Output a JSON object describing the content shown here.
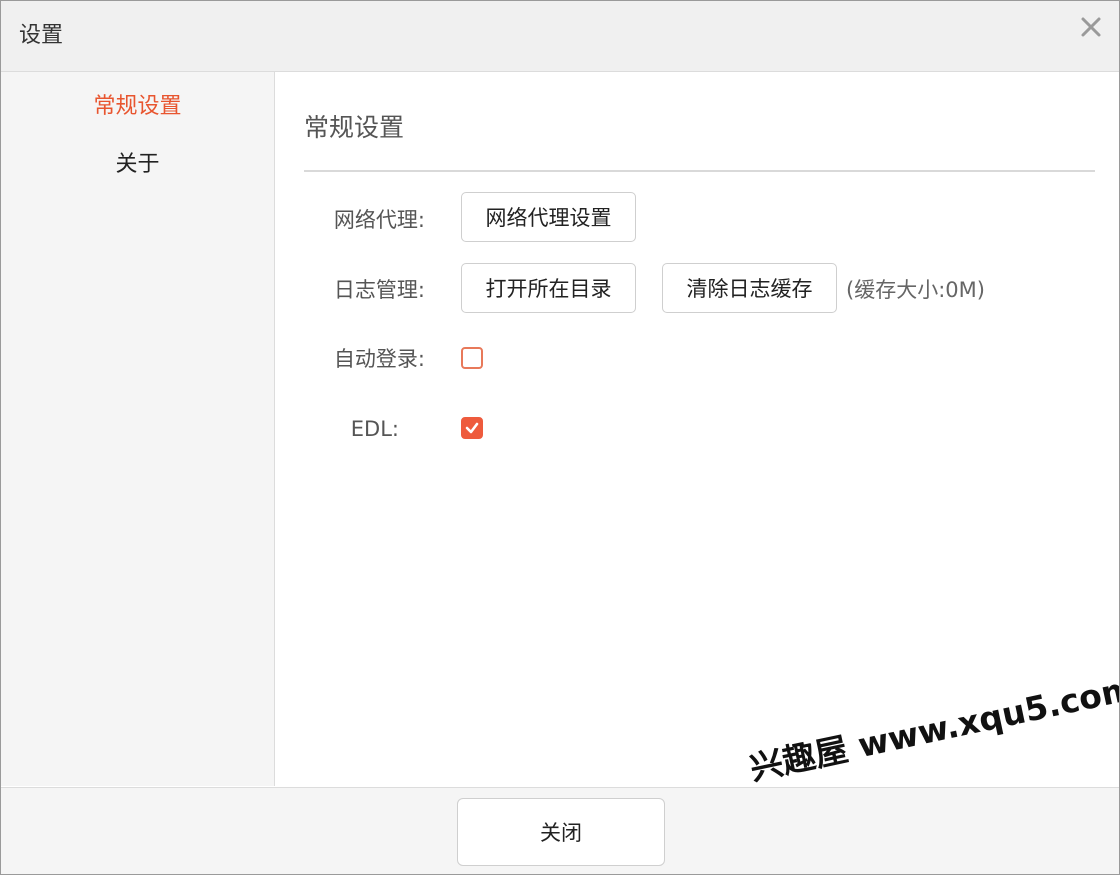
{
  "window": {
    "title": "设置",
    "close_icon": "close-icon"
  },
  "sidebar": {
    "items": [
      {
        "label": "常规设置",
        "active": true
      },
      {
        "label": "关于",
        "active": false
      }
    ],
    "active_color": "#e8552f"
  },
  "main": {
    "section_title": "常规设置",
    "rows": {
      "proxy": {
        "label": "网络代理:",
        "button": "网络代理设置"
      },
      "log": {
        "label": "日志管理:",
        "open_button": "打开所在目录",
        "clear_button": "清除日志缓存",
        "cache_note": "(缓存大小:0M)"
      },
      "auto_login": {
        "label": "自动登录:",
        "checked": false
      },
      "edl": {
        "label": "EDL:",
        "checked": true
      }
    },
    "checkbox_color": "#ee5b3d"
  },
  "footer": {
    "close_button": "关闭"
  },
  "watermark": {
    "text": "兴趣屋 www.xqu5.com"
  }
}
